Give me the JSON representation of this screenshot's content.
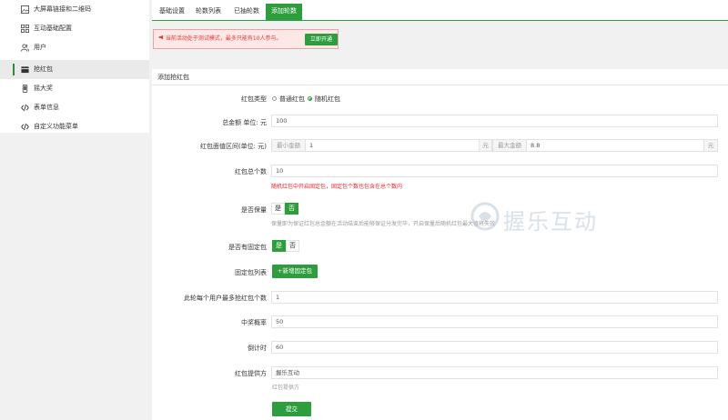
{
  "sidebar": {
    "items": [
      {
        "label": "大屏幕链接和二维码",
        "icon": "image-icon"
      },
      {
        "label": "互动基础配置",
        "icon": "grid-icon"
      },
      {
        "label": "用户",
        "icon": "users-icon"
      },
      {
        "label": "抢红包",
        "icon": "wallet-icon",
        "active": true
      },
      {
        "label": "摇大奖",
        "icon": "phone-icon"
      },
      {
        "label": "表单信息",
        "icon": "code-icon"
      },
      {
        "label": "自定义功能菜单",
        "icon": "code-icon"
      }
    ]
  },
  "tabs": [
    {
      "label": "基础设置"
    },
    {
      "label": "轮数列表"
    },
    {
      "label": "已抽轮数"
    },
    {
      "label": "添加轮数",
      "active": true
    }
  ],
  "notice": {
    "text": "当前活动处于测试模式，最多只能有10人参与。",
    "button": "立即开通"
  },
  "section_title": "添加抢红包",
  "form": {
    "type": {
      "label": "红包类型",
      "options": [
        "普通红包",
        "随机红包"
      ],
      "selected": "随机红包"
    },
    "total": {
      "label": "总金额 单位: 元",
      "value": "100"
    },
    "range": {
      "label": "红包面值区间(单位: 元)",
      "min_prefix": "最小金额",
      "min_value": "1",
      "min_unit": "元",
      "max_prefix": "最大金额",
      "max_value": "8.8",
      "max_unit": "元"
    },
    "count": {
      "label": "红包总个数",
      "value": "10",
      "hint": "随机红包中开启固定包，固定包个数也包含在总个数内"
    },
    "guarantee": {
      "label": "是否保量",
      "yes": "是",
      "no": "否",
      "selected": "否",
      "hint": "保量即为保证红包总金额在活动结束后能够保证分发完毕，开启保量后随机红包最大值将失效"
    },
    "fixed": {
      "label": "是否有固定包",
      "yes": "是",
      "no": "否",
      "selected": "是"
    },
    "fixed_list": {
      "label": "固定包列表",
      "button": "+新增固定包"
    },
    "max_per_user": {
      "label": "此轮每个用户最多抢红包个数",
      "value": "1"
    },
    "win_rate": {
      "label": "中奖概率",
      "value": "50"
    },
    "countdown": {
      "label": "倒计时",
      "value": "60"
    },
    "provider": {
      "label": "红包提供方",
      "value": "握乐互动",
      "hint": "红包提供方"
    },
    "submit": "提交"
  },
  "watermark": {
    "text": "握乐互动"
  },
  "colors": {
    "accent": "#2e9d3d",
    "notice_text": "#ee3333",
    "notice_bg": "#fde8e8"
  }
}
